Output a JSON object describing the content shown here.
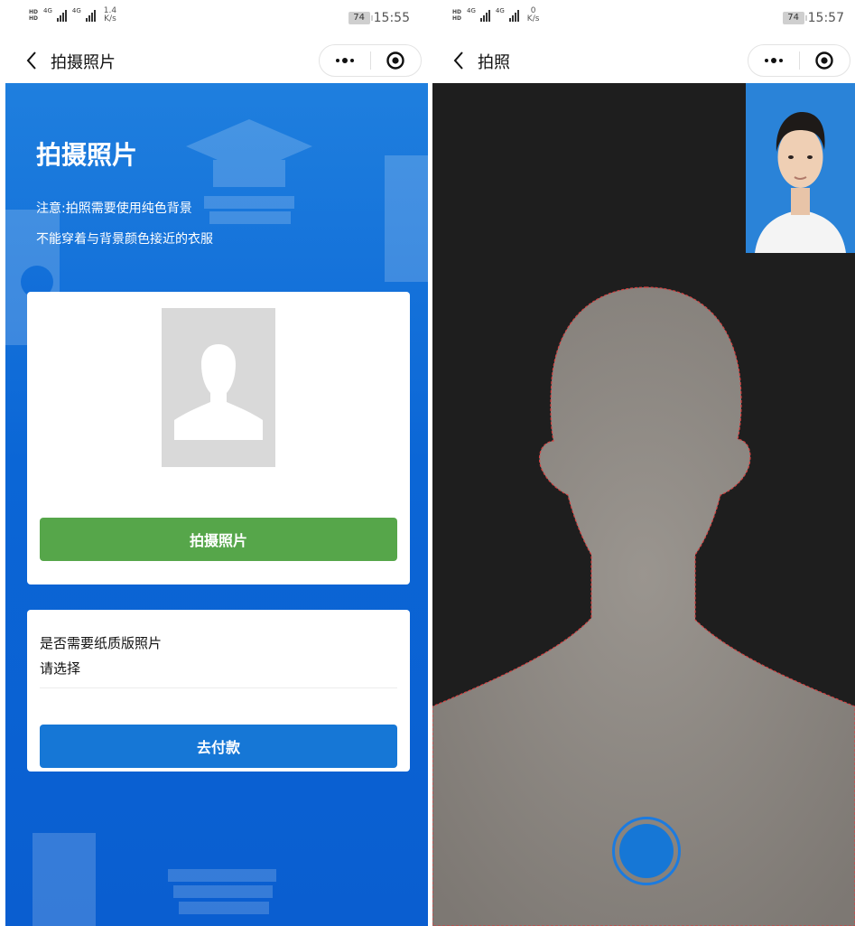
{
  "left_screen": {
    "status": {
      "speed_value": "1.4",
      "speed_unit": "K/s",
      "battery": "74",
      "time": "15:55",
      "sim1": "HD",
      "sim2": "HD",
      "net1": "4G",
      "net2": "4G"
    },
    "nav": {
      "title": "拍摄照片"
    },
    "heading": "拍摄照片",
    "notice_line1": "注意:拍照需要使用纯色背景",
    "notice_line2": "不能穿着与背景颜色接近的衣服",
    "take_photo_button": "拍摄照片",
    "paper_question": "是否需要纸质版照片",
    "paper_select_value": "请选择",
    "pay_button": "去付款"
  },
  "right_screen": {
    "status": {
      "speed_value": "0",
      "speed_unit": "K/s",
      "battery": "74",
      "time": "15:57",
      "sim1": "HD",
      "sim2": "HD",
      "net1": "4G",
      "net2": "4G"
    },
    "nav": {
      "title": "拍照"
    }
  },
  "colors": {
    "blue_bg": "#0b66d6",
    "green_button": "#56a64a",
    "blue_button": "#1677d6",
    "camera_bg": "#1e1e1e",
    "silhouette": "#8f8a84",
    "silhouette_outline": "#d94040"
  },
  "icons": {
    "back": "chevron-left-icon",
    "more": "more-dots-icon",
    "close": "target-circle-icon",
    "avatar_placeholder": "person-silhouette-icon",
    "shutter": "shutter-button-icon"
  }
}
